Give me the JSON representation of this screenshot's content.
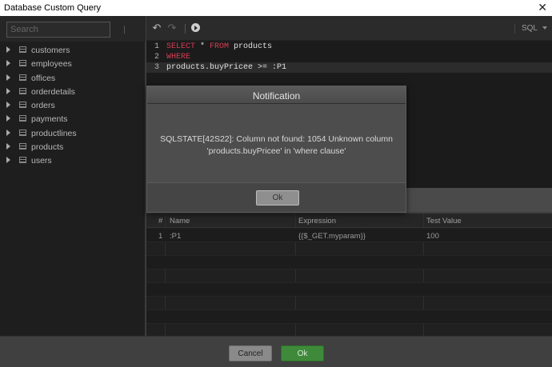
{
  "window": {
    "title": "Database Custom Query",
    "close_glyph": "✕"
  },
  "sidebar": {
    "search_placeholder": "Search",
    "tables": [
      {
        "label": "customers"
      },
      {
        "label": "employees"
      },
      {
        "label": "offices"
      },
      {
        "label": "orderdetails"
      },
      {
        "label": "orders"
      },
      {
        "label": "payments"
      },
      {
        "label": "productlines"
      },
      {
        "label": "products"
      },
      {
        "label": "users"
      }
    ]
  },
  "toolbar": {
    "undo_icon": "↶",
    "redo_icon": "↷",
    "language": "SQL"
  },
  "editor": {
    "lines": [
      {
        "num": "1",
        "kw1": "SELECT",
        "mid": " * ",
        "kw2": "FROM",
        "rest": " products"
      },
      {
        "num": "2",
        "kw1": "WHERE",
        "mid": "",
        "kw2": "",
        "rest": ""
      },
      {
        "num": "3",
        "kw1": "",
        "mid": "",
        "kw2": "",
        "rest": "products.buyPricee >= :P1"
      }
    ]
  },
  "params": {
    "headers": {
      "num": "#",
      "name": "Name",
      "expression": "Expression",
      "test_value": "Test Value"
    },
    "rows": [
      {
        "num": "1",
        "name": ":P1",
        "expression": "{{$_GET.myparam}}",
        "test_value": "100"
      }
    ]
  },
  "footer": {
    "cancel_label": "Cancel",
    "ok_label": "Ok"
  },
  "notification": {
    "title": "Notification",
    "message_line1": "SQLSTATE[42S22]: Column not found: 1054 Unknown column",
    "message_line2": "'products.buyPricee' in 'where clause'",
    "ok_label": "Ok"
  },
  "colors": {
    "keyword": "#d43d55",
    "ok_button": "#3e8a3a"
  }
}
